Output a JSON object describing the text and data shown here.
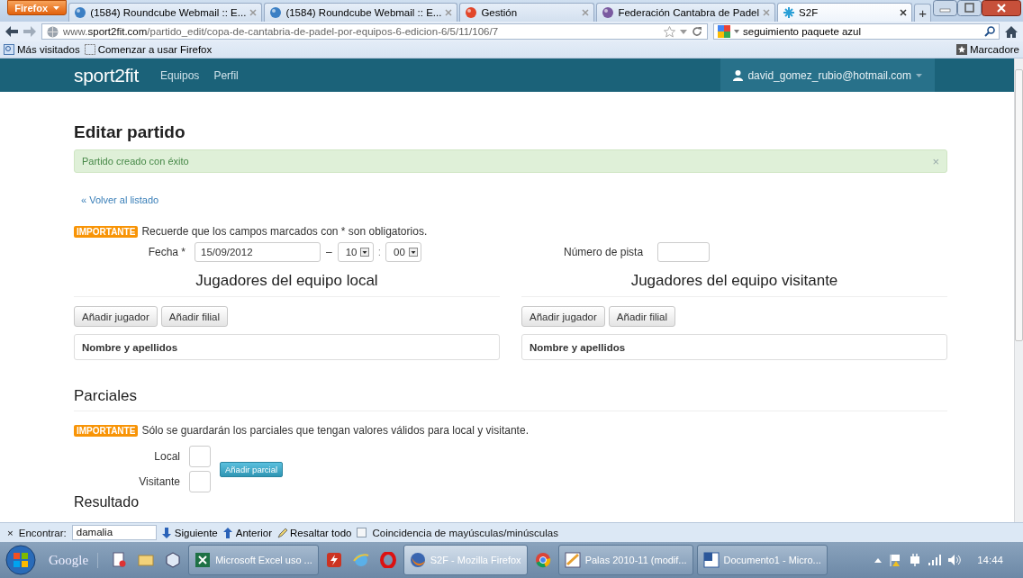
{
  "browser": {
    "menu_button": "Firefox",
    "tabs": [
      {
        "title": "(1584) Roundcube Webmail :: E...",
        "selected": false
      },
      {
        "title": "(1584) Roundcube Webmail :: E...",
        "selected": false
      },
      {
        "title": "Gestión",
        "selected": false
      },
      {
        "title": "Federación Cantabra de Padel",
        "selected": false
      },
      {
        "title": "S2F",
        "selected": true
      }
    ],
    "new_tab": "+",
    "url": "www.**sport2fit.com**/partido_edit/copa-de-cantabria-de-padel-por-equipos-6-edicion-6/5/11/106/7",
    "search": "seguimiento paquete azul",
    "bookmarks": [
      "Más visitados",
      "Comenzar a usar Firefox"
    ],
    "bookmarks_menu": "Marcadore"
  },
  "site": {
    "brand": "sport2fit",
    "nav": [
      "Equipos",
      "Perfil"
    ],
    "user": "david_gomez_rubio@hotmail.com"
  },
  "page": {
    "title": "Editar partido",
    "alert": {
      "text": "Partido creado con éxito",
      "close": "×"
    },
    "back_link": "« Volver al listado",
    "notice": {
      "badge": "IMPORTANTE",
      "text": "Recuerde que los campos marcados con * son obligatorios."
    },
    "date": {
      "label": "Fecha *",
      "value": "15/09/2012",
      "dash": "–",
      "hour": "10",
      "colon": ":",
      "minute": "00"
    },
    "court": {
      "label": "Número de pista"
    },
    "teams": [
      {
        "heading": "Jugadores del equipo local",
        "buttons": [
          "Añadir jugador",
          "Añadir filial"
        ],
        "column": "Nombre y apellidos"
      },
      {
        "heading": "Jugadores del equipo visitante",
        "buttons": [
          "Añadir jugador",
          "Añadir filial"
        ],
        "column": "Nombre y apellidos"
      }
    ],
    "partials": {
      "heading": "Parciales",
      "notice": {
        "badge": "IMPORTANTE",
        "text": "Sólo se guardarán los parciales que tengan valores válidos para local y visitante."
      },
      "local_label": "Local",
      "visitor_label": "Visitante",
      "add_button": "Añadir parcial"
    },
    "result_heading": "Resultado"
  },
  "find_bar": {
    "close": "×",
    "label": "Encontrar:",
    "value": "damalia",
    "buttons": [
      "Siguiente",
      "Anterior",
      "Resaltar todo"
    ],
    "match_case": {
      "label": "Coincidencia de mayúsculas/minúsculas",
      "checked": false
    }
  },
  "taskbar": {
    "toolbar": "Google",
    "items": [
      {
        "kind": "pinned"
      },
      {
        "kind": "pinned"
      },
      {
        "kind": "pinned"
      },
      {
        "kind": "window",
        "label": "Microsoft Excel uso ...",
        "selected": false
      },
      {
        "kind": "pinned"
      },
      {
        "kind": "pinned"
      },
      {
        "kind": "pinned"
      },
      {
        "kind": "window",
        "label": "S2F - Mozilla Firefox",
        "selected": true
      },
      {
        "kind": "pinned"
      },
      {
        "kind": "window",
        "label": "Palas 2010-11 (modif...",
        "selected": false
      },
      {
        "kind": "window",
        "label": "Documento1 - Micro...",
        "selected": false
      }
    ],
    "clock": "14:44"
  }
}
